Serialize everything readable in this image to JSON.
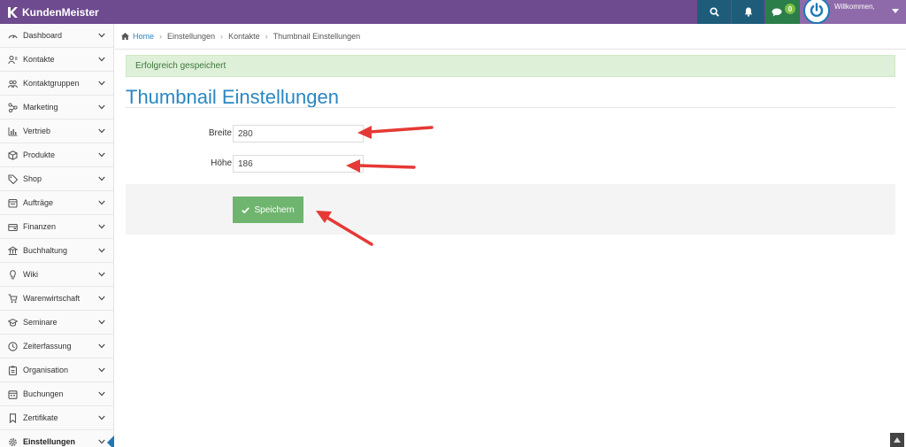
{
  "app": {
    "brand": "KundenMeister"
  },
  "topbar": {
    "search_icon": "search-icon",
    "bell_icon": "bell-icon",
    "chat_badge": "0",
    "user_welcome": "Willkommen,"
  },
  "sidebar": {
    "items": [
      {
        "label": "Dashboard",
        "icon": "dashboard-icon"
      },
      {
        "label": "Kontakte",
        "icon": "contacts-icon"
      },
      {
        "label": "Kontaktgruppen",
        "icon": "group-icon"
      },
      {
        "label": "Marketing",
        "icon": "marketing-icon"
      },
      {
        "label": "Vertrieb",
        "icon": "chart-icon"
      },
      {
        "label": "Produkte",
        "icon": "box-icon"
      },
      {
        "label": "Shop",
        "icon": "tag-icon"
      },
      {
        "label": "Aufträge",
        "icon": "orders-icon"
      },
      {
        "label": "Finanzen",
        "icon": "finance-icon"
      },
      {
        "label": "Buchhaltung",
        "icon": "bank-icon"
      },
      {
        "label": "Wiki",
        "icon": "bulb-icon"
      },
      {
        "label": "Warenwirtschaft",
        "icon": "cart-icon"
      },
      {
        "label": "Seminare",
        "icon": "graduation-icon"
      },
      {
        "label": "Zeiterfassung",
        "icon": "clock-icon"
      },
      {
        "label": "Organisation",
        "icon": "clipboard-icon"
      },
      {
        "label": "Buchungen",
        "icon": "calendar-icon"
      },
      {
        "label": "Zertifikate",
        "icon": "bookmark-icon"
      },
      {
        "label": "Einstellungen",
        "icon": "gear-icon",
        "active": true
      }
    ]
  },
  "breadcrumb": {
    "home": "Home",
    "items": [
      "Einstellungen",
      "Kontakte",
      "Thumbnail Einstellungen"
    ]
  },
  "alert": {
    "message": "Erfolgreich gespeichert"
  },
  "page": {
    "title": "Thumbnail Einstellungen"
  },
  "form": {
    "width_label": "Breite",
    "width_value": "280",
    "height_label": "Höhe",
    "height_value": "186",
    "save_label": "Speichern"
  },
  "colors": {
    "topbar": "#6e4a8e",
    "accent": "#2a87c1",
    "success_bg": "#dff0d8",
    "save_button": "#6fb56f",
    "annotation_arrow": "#e53935"
  }
}
